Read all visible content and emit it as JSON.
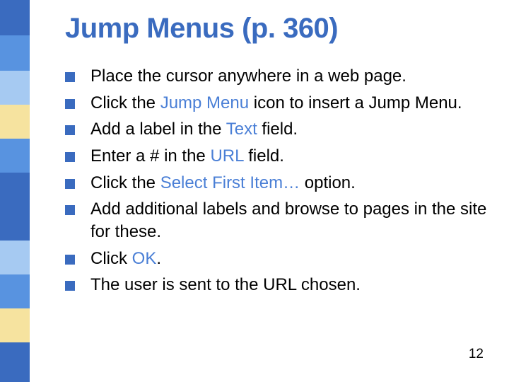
{
  "title": "Jump Menus (p. 360)",
  "bullets": [
    {
      "segments": [
        {
          "text": "Place the cursor anywhere in a web page."
        }
      ]
    },
    {
      "segments": [
        {
          "text": "Click the "
        },
        {
          "text": "Jump Menu",
          "link": true
        },
        {
          "text": " icon to insert a Jump Menu."
        }
      ]
    },
    {
      "segments": [
        {
          "text": "Add a label in the "
        },
        {
          "text": "Text",
          "link": true
        },
        {
          "text": " field."
        }
      ]
    },
    {
      "segments": [
        {
          "text": "Enter a # in the "
        },
        {
          "text": "URL",
          "link": true
        },
        {
          "text": " field."
        }
      ]
    },
    {
      "segments": [
        {
          "text": "Click the "
        },
        {
          "text": "Select First Item…",
          "link": true
        },
        {
          "text": " option."
        }
      ]
    },
    {
      "segments": [
        {
          "text": "Add additional labels and browse to pages in the site for these."
        }
      ]
    },
    {
      "segments": [
        {
          "text": "Click "
        },
        {
          "text": "OK",
          "link": true
        },
        {
          "text": "."
        }
      ]
    },
    {
      "segments": [
        {
          "text": "The user is sent to the URL chosen."
        }
      ]
    }
  ],
  "page_number": "12"
}
